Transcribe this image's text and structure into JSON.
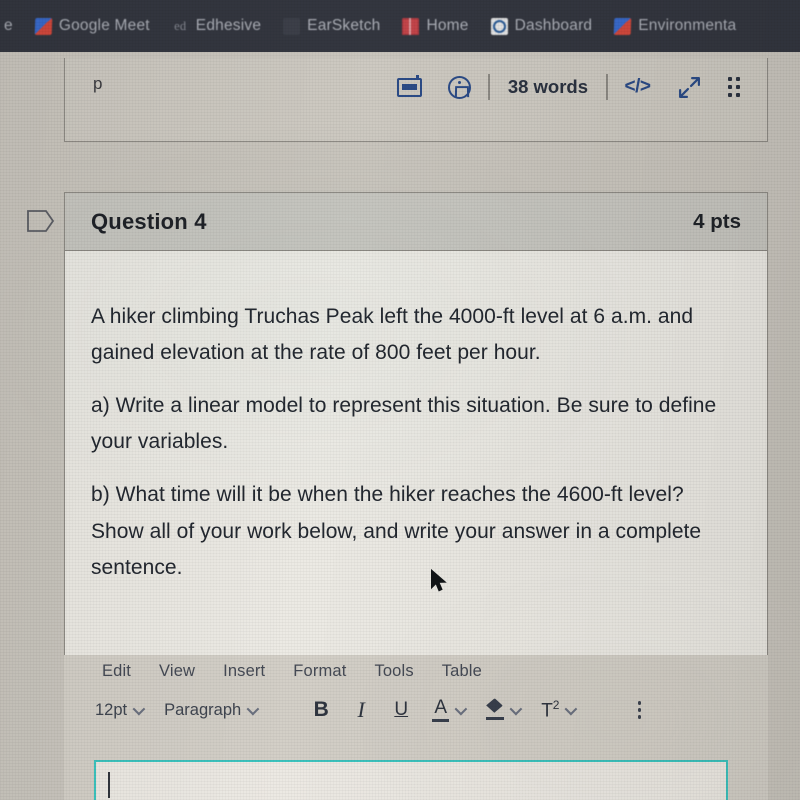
{
  "browser": {
    "bookmarks": [
      {
        "label": "e",
        "icon": "partial-tab-label",
        "partial": true
      },
      {
        "label": "Google Meet",
        "icon": "google-meet-icon"
      },
      {
        "label": "Edhesive",
        "icon": "edhesive-icon"
      },
      {
        "label": "EarSketch",
        "icon": "earsketch-icon"
      },
      {
        "label": "Home",
        "icon": "home-book-icon"
      },
      {
        "label": "Dashboard",
        "icon": "dashboard-icon"
      },
      {
        "label": "Environmenta",
        "icon": "environmental-icon"
      }
    ]
  },
  "top_panel": {
    "element_path": "p",
    "keyboard_icon": "keyboard-icon",
    "accessibility_icon": "accessibility-checker-icon",
    "word_count": "38 words",
    "html_editor_label": "</>",
    "fullscreen_icon": "expand-arrows-icon",
    "drag_handle_icon": "drag-handle-icon"
  },
  "question": {
    "flag_icon": "bookmark-flag-icon",
    "title": "Question 4",
    "points": "4 pts",
    "paragraphs": [
      "A hiker climbing Truchas Peak left the 4000-ft level at 6 a.m. and gained elevation at the rate of 800 feet per hour.",
      "a) Write a linear model to represent this situation. Be sure to define your variables.",
      "b) What time will it be when the hiker reaches the 4600-ft level?  Show all of your work below, and write your answer in a complete sentence."
    ]
  },
  "editor": {
    "menus": [
      "Edit",
      "View",
      "Insert",
      "Format",
      "Tools",
      "Table"
    ],
    "toolbar": {
      "font_size": "12pt",
      "block_format": "Paragraph",
      "bold_label": "B",
      "italic_label": "I",
      "underline_label": "U",
      "text_color_label": "A",
      "text_color_icon": "text-color-icon",
      "highlight_icon": "highlight-color-icon",
      "superscript_label": "T",
      "superscript_exponent": "2",
      "more_options_icon": "more-options-icon",
      "dropdown_icon": "chevron-down-icon"
    },
    "compose_placeholder": ""
  },
  "pointer": {
    "cursor_icon": "mouse-pointer-icon"
  },
  "colors": {
    "bookmark_bar_bg": "#33363f",
    "page_bg": "#c9c5bd",
    "question_header_bg": "#c7c6c0",
    "question_body_bg": "#eceae4",
    "toolbar_icon_blue": "#2b4b87",
    "focus_teal": "#3cc4bf",
    "text_dark": "#232830"
  }
}
